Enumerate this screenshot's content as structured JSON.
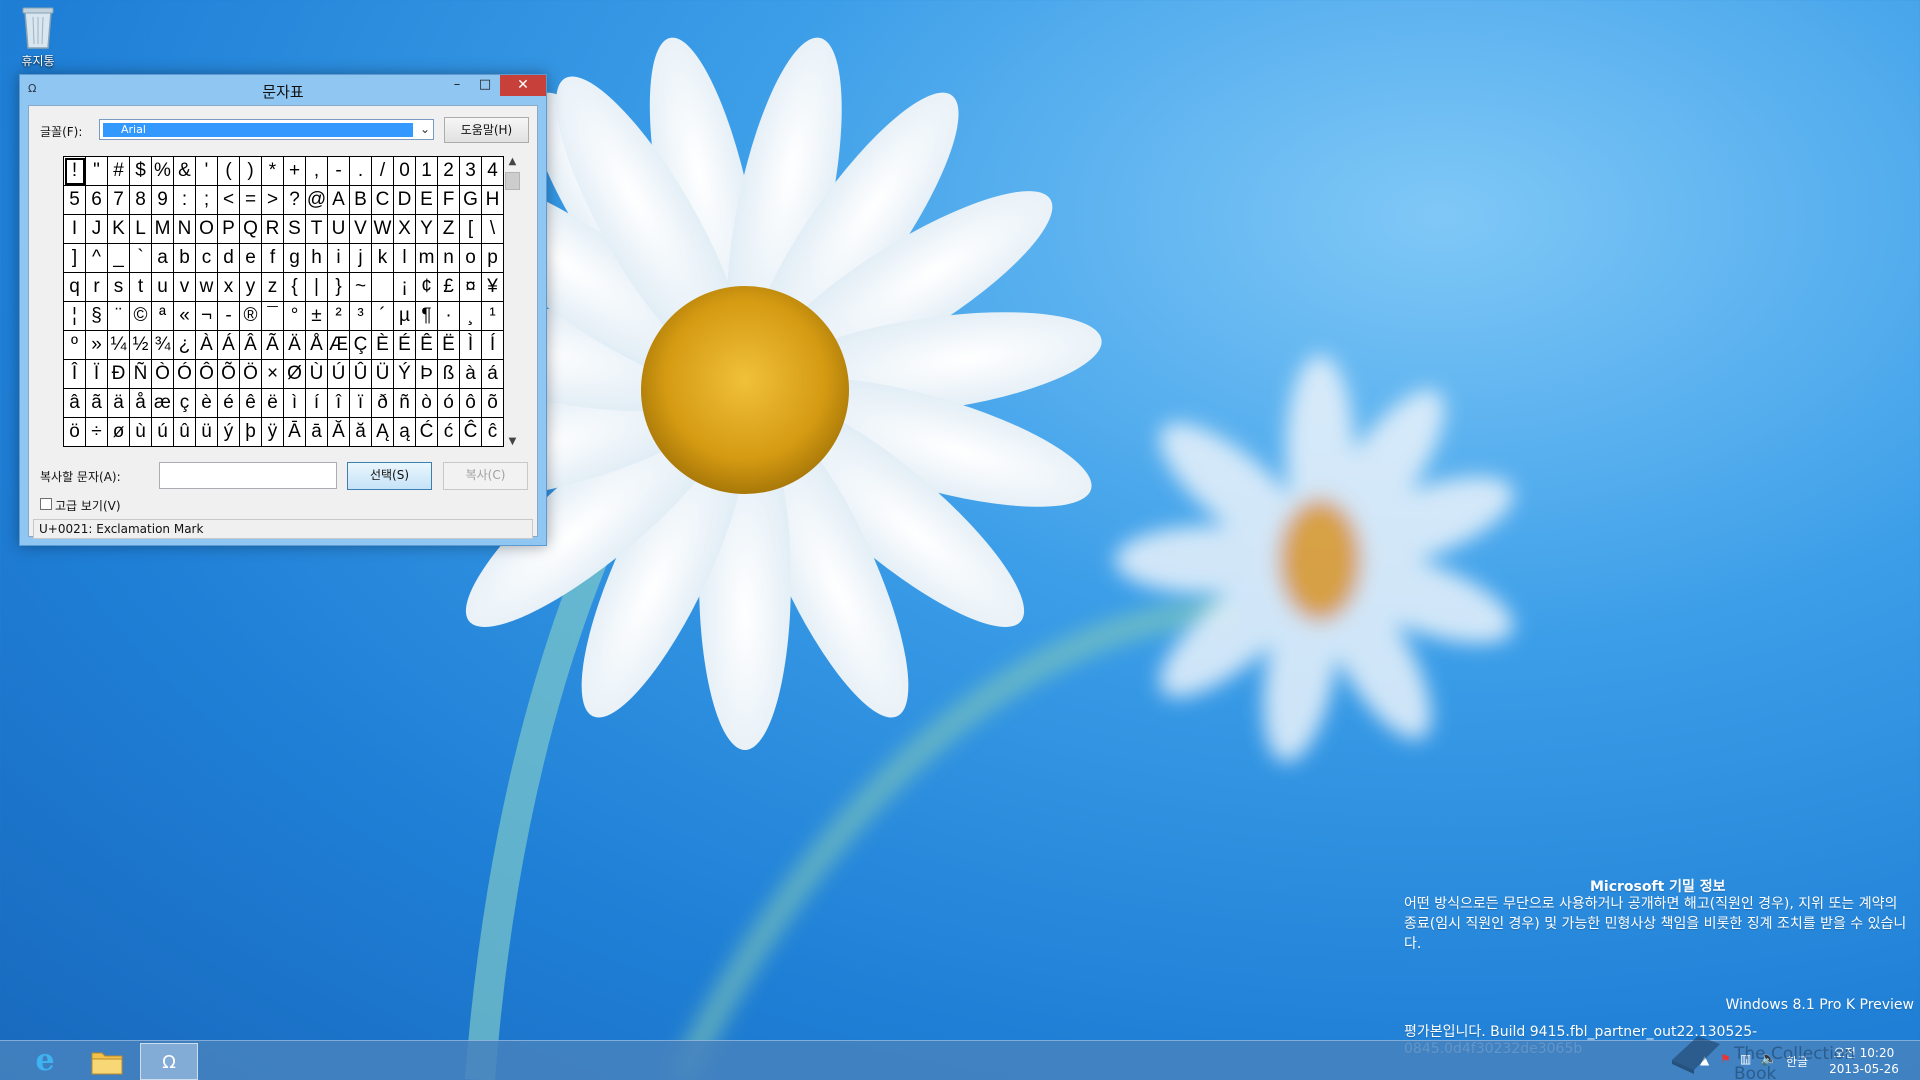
{
  "desktop": {
    "recycle_bin_label": "휴지통"
  },
  "window": {
    "title": "문자표",
    "minimize_glyph": "–",
    "maximize_glyph": "□",
    "close_glyph": "✕",
    "font_label": "글꼴(F):",
    "font_value": "Arial",
    "help_button": "도움말(H)",
    "characters": [
      "!",
      "\"",
      "#",
      "$",
      "%",
      "&",
      "'",
      "(",
      ")",
      "*",
      "+",
      ",",
      "-",
      ".",
      "/",
      "0",
      "1",
      "2",
      "3",
      "4",
      "5",
      "6",
      "7",
      "8",
      "9",
      ":",
      ";",
      "<",
      "=",
      ">",
      "?",
      "@",
      "A",
      "B",
      "C",
      "D",
      "E",
      "F",
      "G",
      "H",
      "I",
      "J",
      "K",
      "L",
      "M",
      "N",
      "O",
      "P",
      "Q",
      "R",
      "S",
      "T",
      "U",
      "V",
      "W",
      "X",
      "Y",
      "Z",
      "[",
      "\\",
      "]",
      "^",
      "_",
      "`",
      "a",
      "b",
      "c",
      "d",
      "e",
      "f",
      "g",
      "h",
      "i",
      "j",
      "k",
      "l",
      "m",
      "n",
      "o",
      "p",
      "q",
      "r",
      "s",
      "t",
      "u",
      "v",
      "w",
      "x",
      "y",
      "z",
      "{",
      "|",
      "}",
      "~",
      " ",
      "¡",
      "¢",
      "£",
      "¤",
      "¥",
      "¦",
      "§",
      "¨",
      "©",
      "ª",
      "«",
      "¬",
      "-",
      "®",
      "¯",
      "°",
      "±",
      "²",
      "³",
      "´",
      "µ",
      "¶",
      "·",
      "¸",
      "¹",
      "º",
      "»",
      "¼",
      "½",
      "¾",
      "¿",
      "À",
      "Á",
      "Â",
      "Ã",
      "Ä",
      "Å",
      "Æ",
      "Ç",
      "È",
      "É",
      "Ê",
      "Ë",
      "Ì",
      "Í",
      "Î",
      "Ï",
      "Ð",
      "Ñ",
      "Ò",
      "Ó",
      "Ô",
      "Õ",
      "Ö",
      "×",
      "Ø",
      "Ù",
      "Ú",
      "Û",
      "Ü",
      "Ý",
      "Þ",
      "ß",
      "à",
      "á",
      "â",
      "ã",
      "ä",
      "å",
      "æ",
      "ç",
      "è",
      "é",
      "ê",
      "ë",
      "ì",
      "í",
      "î",
      "ï",
      "ð",
      "ñ",
      "ò",
      "ó",
      "ô",
      "õ",
      "ö",
      "÷",
      "ø",
      "ù",
      "ú",
      "û",
      "ü",
      "ý",
      "þ",
      "ÿ",
      "Ā",
      "ā",
      "Ă",
      "ă",
      "Ą",
      "ą",
      "Ć",
      "ć",
      "Ĉ",
      "ĉ"
    ],
    "copy_label": "복사할 문자(A):",
    "copy_value": "",
    "select_button": "선택(S)",
    "copy_button": "복사(C)",
    "advanced_label": "고급 보기(V)",
    "advanced_checked": false,
    "status_text": "U+0021: Exclamation Mark"
  },
  "watermark": {
    "title": "Microsoft 기밀 정보",
    "body": "어떤 방식으로든 무단으로 사용하거나 공개하면 해고(직원인 경우), 지위 또는 계약의 종료(임시 직원인 경우) 및 가능한 민형사상 책임을 비롯한 징계 조치를 받을 수 있습니다.",
    "edition": "Windows 8.1 Pro K Preview",
    "build": "평가본입니다. Build 9415.fbl_partner_out22.130525-0845.0d4f30232de3065b"
  },
  "taskbar": {
    "apps": [
      {
        "name": "internet-explorer",
        "icon": "ie-icon"
      },
      {
        "name": "file-explorer",
        "icon": "folder-icon"
      },
      {
        "name": "character-map",
        "icon": "charmap-icon",
        "active": true
      }
    ],
    "ime_label": "한글",
    "clock_time": "오전 10:20",
    "clock_date": "2013-05-26",
    "overlay_logo": "The Collection Book"
  },
  "colors": {
    "accent": "#3399ff",
    "close_button": "#c7403a",
    "window_frame": "#8fc6f2"
  }
}
